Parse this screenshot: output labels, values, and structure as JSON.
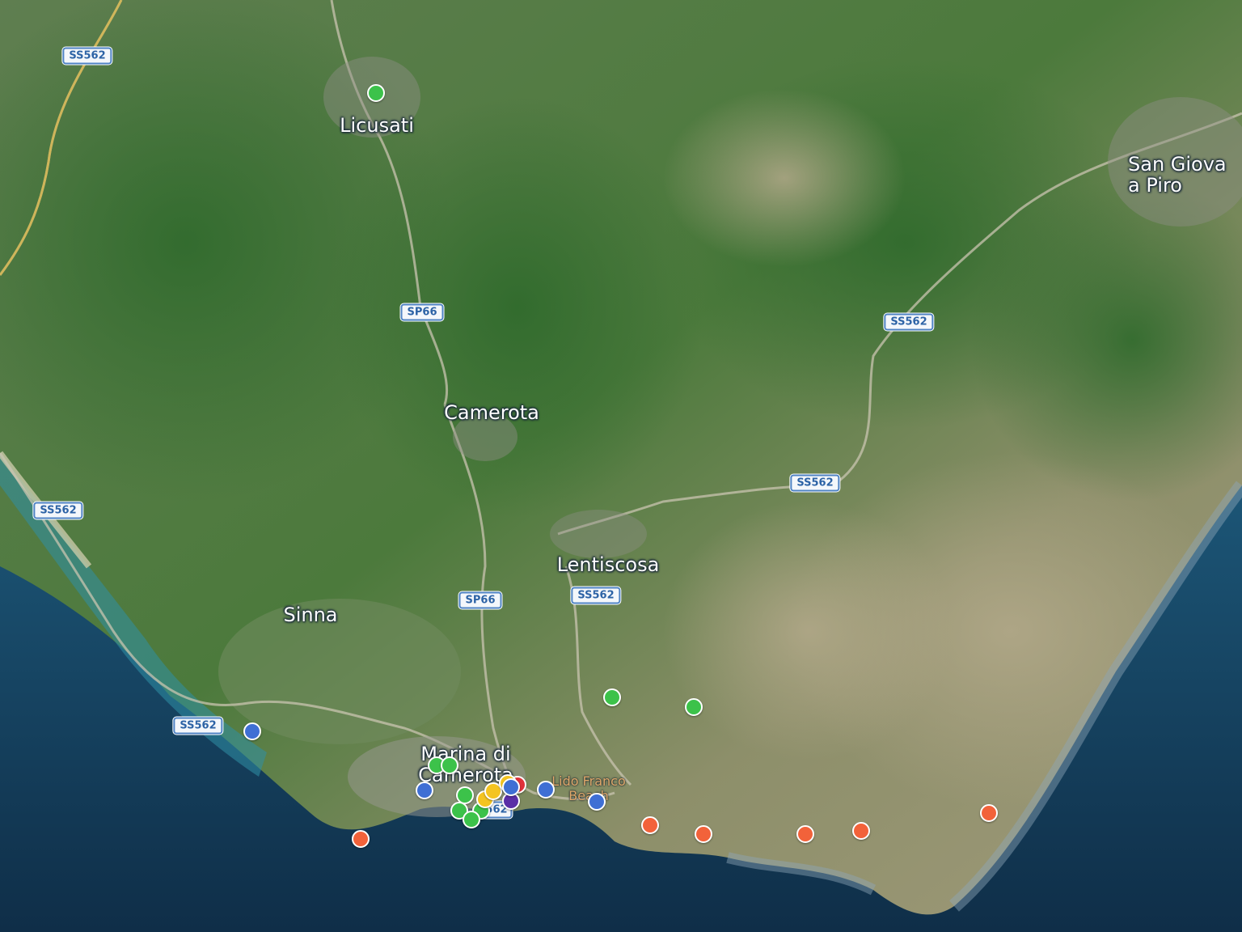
{
  "map": {
    "style": "satellite",
    "places": [
      {
        "id": "licusati",
        "name": "Licusati"
      },
      {
        "id": "camerota",
        "name": "Camerota"
      },
      {
        "id": "lentiscosa",
        "name": "Lentiscosa"
      },
      {
        "id": "sinna",
        "name": "Sinna"
      },
      {
        "id": "marina-di-camerota",
        "name": "Marina di\nCamerota"
      },
      {
        "id": "san-giovanni-a-piro",
        "name": "San Giova\na Piro"
      }
    ],
    "poi_labels": [
      {
        "id": "lido-franco-beach",
        "name": "Lido Franco\nBeach"
      }
    ],
    "road_shields": [
      "SS562",
      "SP66",
      "SS562",
      "SS562",
      "SS562",
      "SP66",
      "SS562",
      "SS562",
      "562"
    ],
    "marker_colors": {
      "green": "#3cc24a",
      "blue": "#3f6fd4",
      "orange": "#f2623a",
      "yellow": "#f4c421",
      "purple": "#5a2ea6",
      "red": "#e0313a"
    },
    "markers": [
      {
        "category": "green"
      },
      {
        "category": "green"
      },
      {
        "category": "green"
      },
      {
        "category": "blue"
      },
      {
        "category": "green"
      },
      {
        "category": "green"
      },
      {
        "category": "blue"
      },
      {
        "category": "green"
      },
      {
        "category": "green"
      },
      {
        "category": "green"
      },
      {
        "category": "green"
      },
      {
        "category": "red"
      },
      {
        "category": "purple"
      },
      {
        "category": "yellow"
      },
      {
        "category": "yellow"
      },
      {
        "category": "yellow"
      },
      {
        "category": "blue"
      },
      {
        "category": "blue"
      },
      {
        "category": "blue"
      },
      {
        "category": "orange"
      },
      {
        "category": "orange"
      },
      {
        "category": "orange"
      },
      {
        "category": "orange"
      },
      {
        "category": "orange"
      },
      {
        "category": "orange"
      }
    ]
  }
}
